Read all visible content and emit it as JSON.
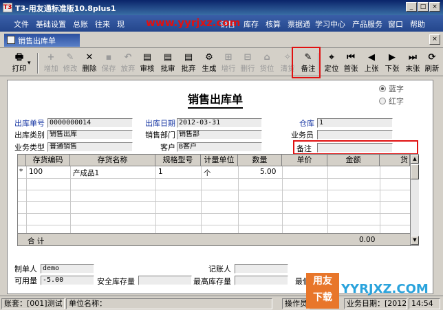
{
  "window": {
    "title": "T3-用友通标准版10.8plus1",
    "app_icon": "T3",
    "watermark": "www.yyrjxz.com",
    "buttons": [
      "_",
      "□",
      "×"
    ]
  },
  "menu": [
    "文件",
    "基础设置",
    "总账",
    "往来",
    "现",
    "销售",
    "库存",
    "核算",
    "票据通",
    "学习中心",
    "产品服务",
    "窗口",
    "帮助"
  ],
  "doc_tab": {
    "label": "销售出库单",
    "close": "×"
  },
  "toolbar": [
    {
      "label": "打印",
      "icon": "printer-icon",
      "glyph": "🖶",
      "enabled": true
    },
    {
      "label": "增加",
      "icon": "add-icon",
      "glyph": "+",
      "enabled": false
    },
    {
      "label": "修改",
      "icon": "edit-icon",
      "glyph": "✎",
      "enabled": false
    },
    {
      "label": "删除",
      "icon": "delete-icon",
      "glyph": "✕",
      "enabled": true
    },
    {
      "label": "保存",
      "icon": "save-icon",
      "glyph": "▪",
      "enabled": false
    },
    {
      "label": "放弃",
      "icon": "discard-icon",
      "glyph": "↶",
      "enabled": false
    },
    {
      "label": "审核",
      "icon": "audit-icon",
      "glyph": "▤",
      "enabled": true
    },
    {
      "label": "批审",
      "icon": "batch-audit-icon",
      "glyph": "▤",
      "enabled": true
    },
    {
      "label": "批弃",
      "icon": "batch-abandon-icon",
      "glyph": "▤",
      "enabled": true
    },
    {
      "label": "生成",
      "icon": "generate-icon",
      "glyph": "⚙",
      "enabled": true
    },
    {
      "label": "增行",
      "icon": "add-row-icon",
      "glyph": "⊞",
      "enabled": false
    },
    {
      "label": "删行",
      "icon": "delete-row-icon",
      "glyph": "⊟",
      "enabled": false
    },
    {
      "label": "货位",
      "icon": "location-icon",
      "glyph": "⌂",
      "enabled": false
    },
    {
      "label": "清货",
      "icon": "clear-icon",
      "glyph": "✧",
      "enabled": false
    },
    {
      "label": "备注",
      "icon": "note-icon",
      "glyph": "✎",
      "enabled": true
    },
    {
      "label": "定位",
      "icon": "locate-icon",
      "glyph": "⌖",
      "enabled": true
    },
    {
      "label": "首张",
      "icon": "first-icon",
      "glyph": "⏮",
      "enabled": true
    },
    {
      "label": "上张",
      "icon": "prev-icon",
      "glyph": "◀",
      "enabled": true
    },
    {
      "label": "下张",
      "icon": "next-icon",
      "glyph": "▶",
      "enabled": true
    },
    {
      "label": "末张",
      "icon": "last-icon",
      "glyph": "⏭",
      "enabled": true
    },
    {
      "label": "刷新",
      "icon": "refresh-icon",
      "glyph": "⟳",
      "enabled": true
    }
  ],
  "form": {
    "title": "销售出库单",
    "radio_blue": "蓝字",
    "radio_red": "红字",
    "fields": {
      "out_no_label": "出库单号",
      "out_no": "0000000014",
      "out_date_label": "出库日期",
      "out_date": "2012-03-31",
      "warehouse_label": "仓库",
      "warehouse": "1",
      "out_type_label": "出库类别",
      "out_type": "销售出库",
      "sales_dept_label": "销售部门",
      "sales_dept": "销售部",
      "salesman_label": "业务员",
      "salesman": "",
      "biz_type_label": "业务类型",
      "biz_type": "普通销售",
      "customer_label": "客户",
      "customer": "B客户",
      "note_label": "备注",
      "note": ""
    }
  },
  "grid": {
    "columns": [
      "存货编码",
      "存货名称",
      "规格型号",
      "计量单位",
      "数量",
      "单价",
      "金额",
      "货"
    ],
    "rows": [
      {
        "marker": "*",
        "code": "100",
        "name": "产成品1",
        "spec": "1",
        "unit": "个",
        "qty": "5.00",
        "price": "",
        "amount": ""
      }
    ],
    "total_label": "合 计",
    "total_amount": "0.00"
  },
  "footer": {
    "maker_label": "制单人",
    "maker": "demo",
    "accountant_label": "记账人",
    "accountant": "",
    "available_label": "可用量",
    "available": "-5.00",
    "safety_label": "安全库存量",
    "safety": "",
    "max_label": "最高库存量",
    "max": "",
    "min_label": "最低",
    "min": ""
  },
  "status": {
    "account": "账套：[001]测试",
    "unit": "单位名称：",
    "operator": "操作员",
    "biz_date": "业务日期：[2012",
    "time": "14:54"
  },
  "logo": {
    "line1": "用友",
    "line2": "下载"
  },
  "watermark2": "YYRJXZ.COM"
}
